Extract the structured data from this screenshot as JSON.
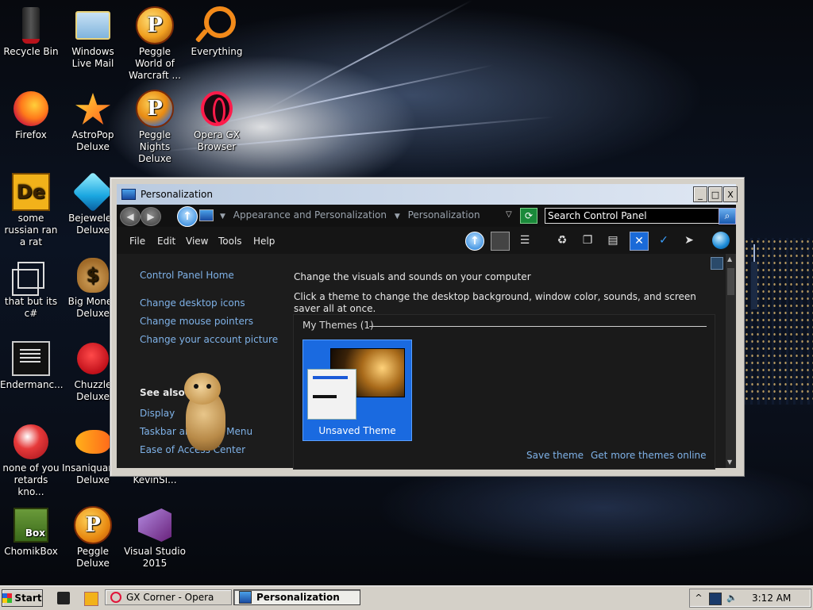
{
  "desktop": {
    "icons": [
      {
        "label": "Recycle Bin",
        "icon": "recycle-bin-icon"
      },
      {
        "label": "Windows Live Mail",
        "icon": "mail-icon"
      },
      {
        "label": "Peggle World of Warcraft ...",
        "icon": "peggle-icon"
      },
      {
        "label": "Everything",
        "icon": "magnifier-icon"
      },
      {
        "label": "Firefox",
        "icon": "firefox-icon"
      },
      {
        "label": "AstroPop Deluxe",
        "icon": "astropop-icon"
      },
      {
        "label": "Peggle Nights Deluxe",
        "icon": "peggle-nights-icon"
      },
      {
        "label": "Opera GX Browser",
        "icon": "opera-gx-icon"
      },
      {
        "label": "some russian ran a rat",
        "icon": "de-icon"
      },
      {
        "label": "Bejeweled Deluxe",
        "icon": "bejeweled-icon"
      },
      {
        "label": "that but its c#",
        "icon": "copy-icon"
      },
      {
        "label": "Big Money Deluxe",
        "icon": "money-bag-icon"
      },
      {
        "label": "Endermanc...",
        "icon": "enderman-icon"
      },
      {
        "label": "Chuzzle Deluxe",
        "icon": "chuzzle-icon"
      },
      {
        "label": "none of you retards kno...",
        "icon": "red-bird-icon"
      },
      {
        "label": "Insaniquarium Deluxe",
        "icon": "fish-icon"
      },
      {
        "label": "KevinSi...",
        "icon": "shortcut-icon"
      },
      {
        "label": "ChomikBox",
        "icon": "chomikbox-icon"
      },
      {
        "label": "Peggle Deluxe",
        "icon": "peggle-deluxe-icon"
      },
      {
        "label": "Visual Studio 2015",
        "icon": "visual-studio-icon"
      }
    ]
  },
  "window": {
    "title": "Personalization",
    "controls": {
      "minimize": "_",
      "maximize": "□",
      "close": "X"
    },
    "address": {
      "back": "◀",
      "forward": "▶",
      "up": "↑",
      "crumbs": [
        "Appearance and Personalization",
        "Personalization"
      ],
      "crumb_sep": "▼",
      "dropdown": "▽",
      "refresh": "⟳",
      "search_placeholder": "Search Control Panel",
      "search_button": "⌕"
    },
    "menu": [
      "File",
      "Edit",
      "View",
      "Tools",
      "Help"
    ],
    "toolbar_icons": [
      "up-icon",
      "folder-view-icon",
      "tree-icon",
      "recycle-icon",
      "copy-icon",
      "document-icon",
      "delete-icon",
      "check-icon",
      "rocket-icon",
      "globe-icon"
    ],
    "sidebar": {
      "home": "Control Panel Home",
      "links": [
        "Change desktop icons",
        "Change mouse pointers",
        "Change your account picture"
      ],
      "see_also": "See also",
      "see_also_links": [
        "Display",
        "Taskbar and Start Menu",
        "Ease of Access Center"
      ]
    },
    "main": {
      "heading": "Change the visuals and sounds on your computer",
      "description": "Click a theme to change the desktop background, window color, sounds, and screen saver all at once.",
      "group_label": "My Themes (1)",
      "theme_name": "Unsaved Theme",
      "save_theme": "Save theme",
      "get_more": "Get more themes online"
    }
  },
  "taskbar": {
    "start": "Start",
    "tasks": [
      {
        "label": "GX Corner - Opera",
        "active": false
      },
      {
        "label": "Personalization",
        "active": true
      }
    ],
    "tray_expand": "^",
    "clock": "3:12 AM"
  }
}
